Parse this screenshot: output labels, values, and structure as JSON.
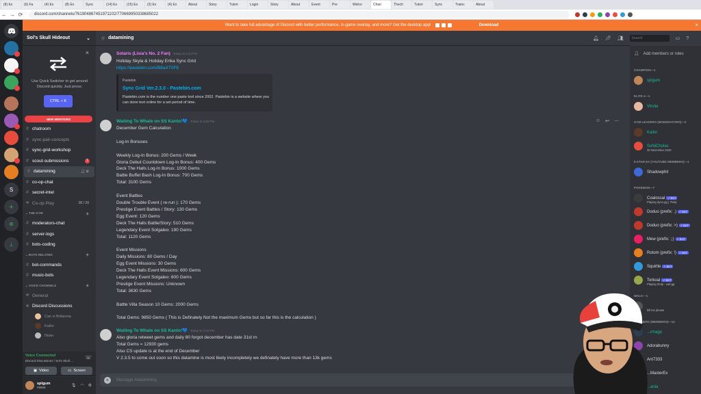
{
  "browser": {
    "tabs": [
      "(8) Ex",
      "(6) Fa",
      "(4) Ex",
      "(8) Ex",
      "Sync",
      "(14) Ex",
      "(15) Ex",
      "(3) Ex",
      "(4) Ex",
      "About",
      "Story",
      "Tutori",
      "Login",
      "Story",
      "About",
      "Event",
      "Pre",
      "Welco",
      "Chari",
      "Thech",
      "Tutori",
      "Sync",
      "Trainc",
      "About"
    ],
    "url": "discord.com/channels/761904867451971102/770669950338685022"
  },
  "notice": {
    "text": "Want to take full advantage of Discord with better performance, in-game overlay, and more? Get the desktop app!",
    "download": "Download"
  },
  "guild": {
    "name": "Sol's Skull Hideout"
  },
  "quick_switcher": {
    "text": "Use Quick Switcher to get around Discord quickly. Just press:",
    "shortcut": "CTRL + K"
  },
  "new_mentions": "NEW MENTIONS",
  "channels": {
    "top": [
      {
        "name": "chatroom",
        "unread": true
      },
      {
        "name": "sync-pair-concepts",
        "unread": false
      },
      {
        "name": "sync-grid-workshop",
        "unread": true
      },
      {
        "name": "scout-submissions",
        "unread": true,
        "badge": "1"
      },
      {
        "name": "datamining",
        "unread": true,
        "active": true
      },
      {
        "name": "co-op-chat",
        "unread": true
      },
      {
        "name": "secret-intel",
        "unread": true
      },
      {
        "name": "Co-op Play",
        "unread": false,
        "voice": true,
        "voice_count": "00 / 20"
      }
    ],
    "cat_gym": "THE GYM",
    "gym": [
      {
        "name": "moderators-chat",
        "unread": true
      },
      {
        "name": "server-logs",
        "unread": true
      },
      {
        "name": "bots-coding",
        "unread": true
      }
    ],
    "cat_bots": "BOTS RELATED",
    "bots": [
      {
        "name": "bot-commands",
        "unread": true
      },
      {
        "name": "music-bots",
        "unread": true
      }
    ],
    "cat_voice": "VOICE CHANNELS",
    "voice": [
      {
        "name": "General",
        "unread": false
      },
      {
        "name": "Discord Discussions",
        "unread": true
      }
    ],
    "voice_users": [
      "Can vi Britannia",
      "Kailor",
      "Noan"
    ]
  },
  "voice_panel": {
    "status": "Voice Connected",
    "sub": "Discord Discussions / Sol's Skull ...",
    "video": "Video",
    "screen": "Screen"
  },
  "user_panel": {
    "name": "splgum",
    "discriminator": "#9909"
  },
  "chat": {
    "channel": "datamining",
    "search_placeholder": "Search",
    "composer_placeholder": "Message #datamining"
  },
  "messages": [
    {
      "author": "Solaris (Lisia's No. 2 Fan)",
      "color": "#f47fff",
      "time": "Today at 2:23 PM",
      "lines": [
        "Holiday Skyla & Holiday Erika Sync Grid"
      ],
      "link": "https://pastebin.com/B8aXT0F8",
      "embed": {
        "provider": "Pastebin",
        "title": "Sync Grid Ver.2.3.0 - Pastebin.com",
        "description": "Pastebin.com is the number one paste tool since 2002. Pastebin is a website where you can store text online for a set period of time."
      }
    },
    {
      "author": "Waiting To Whale on SS Kanto!💙",
      "color": "#1abc9c",
      "time": "Today at 3:59 PM",
      "lines": [
        "December Gem Calculation",
        "",
        "Log-In Bonuses",
        "",
        "Weekly Log-In Bonus: 200 Gems / Week",
        "Gloria Debut Countdown Log-In Bonus: 400 Gems",
        "Deck The Halls Log-In Bonus: 1000 Gems",
        "Battle Buffet Bash Log-In Bonus: 700 Gems",
        "Total: 3100 Gems",
        "",
        "Event Battles",
        "Double Trouble Event ( re-run ): 170 Gems",
        "Prestige Event Battles / Story: 130 Gems",
        "Egg Event: 120 Gems",
        "Deck The Halls Battle/Story: 510 Gems",
        "Legendary Event Solgaleo: 190 Gems",
        "Total: 1120 Gems",
        "",
        "Event Missions",
        "Daily Missions: 80 Gems / Day",
        "Egg Event Missions: 30 Gems",
        "Deck The Halls Event Missions: 600 Gems",
        "Legendary Event Solgaleo: 600 Gems",
        "Prestige Event Missions: Unknown",
        "Total: 3630 Gems",
        "",
        "Battle Villa Season 10 Gems: 2000 Gems",
        "",
        "Total Gems: 9850 Gems ( This is Definately Not the maximum Gems but so far this is the calculation )"
      ]
    },
    {
      "author": "Waiting To Whale on SS Kanto!💙",
      "color": "#1abc9c",
      "time": "Today at 4:03 PM",
      "lines": [
        "Also gloria retweet gems and daily 80 forgot december has date 31st rn",
        "Total Gems = 12930 gems",
        "Also CS update is at the end of December",
        "V 2.3.5 to come out soon so this datamine is most likely incompletely we definately have more than 13k gems"
      ]
    }
  ],
  "members": {
    "add": "Add members or roles",
    "roles": [
      {
        "label": "CHAMPION—1",
        "members": [
          {
            "name": "splgum",
            "color": "#1abc9c",
            "av": "#c0865a"
          }
        ]
      },
      {
        "label": "ELITE 4—1",
        "members": [
          {
            "name": "Vinnie",
            "color": "#1abc9c",
            "av": "#e6b9a0"
          }
        ]
      },
      {
        "label": "GYM LEADERS (MODERATORS)—2",
        "members": [
          {
            "name": "Kailor",
            "color": "#1abc9c",
            "av": "#5b3a29"
          },
          {
            "name": "SoNiCholas",
            "color": "#1abc9c",
            "av": "#e74c3c",
            "sub": "30 November 2020"
          }
        ]
      },
      {
        "label": "6-STAR EX (YOUTUBE MEMBERS)—1",
        "members": [
          {
            "name": "Shadowphil",
            "color": "#dcddde",
            "av": "#3d6ad6"
          }
        ]
      },
      {
        "label": "POKÉMON—7",
        "members": [
          {
            "name": "Coalossal",
            "color": "#dcddde",
            "av": "#3b3b3b",
            "bot": "✓ BOT",
            "sub": "Playing dyno.gg | ?help"
          },
          {
            "name": "Doduo (prefix: .)",
            "color": "#dcddde",
            "av": "#c0392b",
            "bot": "✓ BOT"
          },
          {
            "name": "Doduo (prefix: >)",
            "color": "#dcddde",
            "av": "#c0392b",
            "bot": "✓ BOT"
          },
          {
            "name": "Mew (prefix: ;;)",
            "color": "#dcddde",
            "av": "#e91e63",
            "bot": "✓ BOT"
          },
          {
            "name": "Rotom (prefix: !)",
            "color": "#dcddde",
            "av": "#e67e22",
            "bot": "✓ BOT"
          },
          {
            "name": "Squirtle",
            "color": "#dcddde",
            "av": "#3498db",
            "bot": "✓ BOT"
          },
          {
            "name": "Torkoal",
            "color": "#dcddde",
            "av": "#95a84c",
            "bot": "✓ BOT",
            "sub": "Playing !help - carl.gg"
          }
        ]
      },
      {
        "label": "WALK—1",
        "members": [
          {
            "name": "",
            "color": "#dcddde",
            "av": "#555",
            "sub": "kill me please"
          }
        ]
      },
      {
        "label": "TRAINERS (MEMBERS)—14",
        "members": [
          {
            "name": "...rmage",
            "color": "#1abc9c",
            "av": "#2c3e50"
          },
          {
            "name": "Adorabunny",
            "color": "#dcddde",
            "av": "#8e44ad"
          },
          {
            "name": "Ant7333",
            "color": "#dcddde",
            "av": "#16a085"
          },
          {
            "name": "...MasterEx",
            "color": "#dcddde",
            "av": "#7f8c8d"
          },
          {
            "name": "...ania",
            "color": "#1abc9c",
            "av": "#d35400"
          }
        ]
      }
    ]
  },
  "colors": {
    "accent": "#5865f2",
    "notice": "#f57731",
    "mention": "#ed4245",
    "online": "#3ba55d",
    "teal_name": "#1abc9c",
    "link": "#00b0f4"
  }
}
